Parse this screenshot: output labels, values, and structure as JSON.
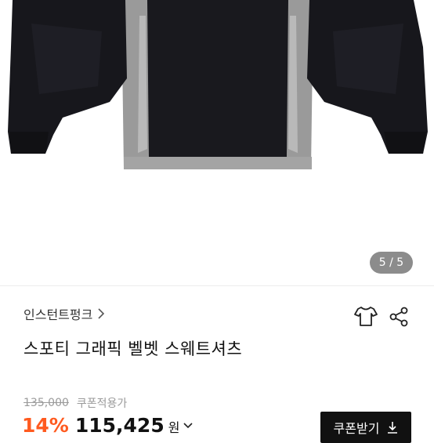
{
  "gallery": {
    "indicator": "5 / 5"
  },
  "product": {
    "brand": "인스턴트펑크",
    "title": "스포티 그래픽 벨벳 스웨트셔츠"
  },
  "pricing": {
    "original_price": "135,000",
    "coupon_label": "쿠폰적용가",
    "discount": "14%",
    "sale_price": "115,425",
    "currency": "원"
  },
  "coupon_button": {
    "label": "쿠폰받기"
  },
  "colors": {
    "accent": "#ff5a1f",
    "dark": "#111111",
    "indicator_bg": "#8c8c8c"
  },
  "icons": [
    "tshirt-size-icon",
    "share-icon",
    "chevron-right-icon",
    "chevron-down-icon",
    "download-icon"
  ]
}
